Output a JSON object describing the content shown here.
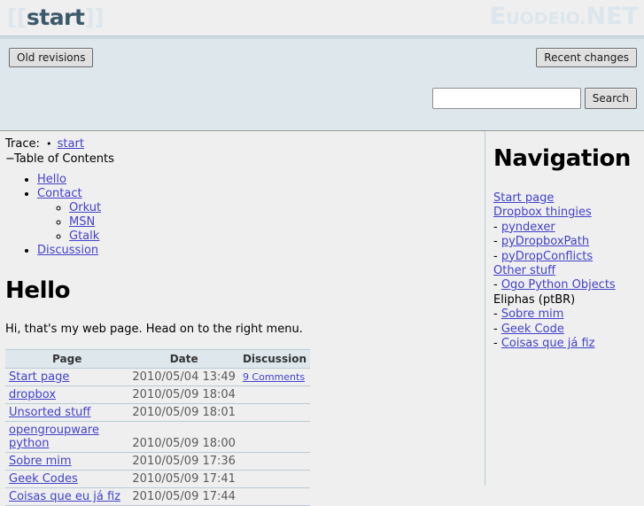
{
  "header": {
    "wiki_title_open": "[[",
    "wiki_title": "start",
    "wiki_title_close": "]]",
    "site_logo_parts": [
      "E",
      "UODEIO",
      ".",
      "NET"
    ],
    "site_logo_text": "Euodeio.NET"
  },
  "toolbar": {
    "old_revisions_label": "Old revisions",
    "recent_changes_label": "Recent changes",
    "search_label": "Search",
    "search_value": "",
    "search_placeholder": ""
  },
  "trace": {
    "label": "Trace:",
    "bullet": "•",
    "items": [
      {
        "label": "start"
      }
    ]
  },
  "toc": {
    "minus": "−",
    "title": "Table of Contents",
    "items": [
      {
        "label": "Hello",
        "level": 1
      },
      {
        "label": "Contact",
        "level": 1
      },
      {
        "label": "Orkut",
        "level": 2
      },
      {
        "label": "MSN",
        "level": 2
      },
      {
        "label": "Gtalk",
        "level": 2
      },
      {
        "label": "Discussion",
        "level": 1
      }
    ]
  },
  "main": {
    "heading": "Hello",
    "intro": "Hi, that's my web page. Head on to the right menu.",
    "table": {
      "columns": [
        "Page",
        "Date",
        "Discussion"
      ],
      "rows": [
        {
          "page": "Start page",
          "date": "2010/05/04 13:49",
          "discussion": "9 Comments"
        },
        {
          "page": "dropbox",
          "date": "2010/05/09 18:04",
          "discussion": ""
        },
        {
          "page": "Unsorted stuff",
          "date": "2010/05/09 18:01",
          "discussion": ""
        },
        {
          "page": "opengroupware python",
          "date": "2010/05/09 18:00",
          "discussion": ""
        },
        {
          "page": "Sobre mim",
          "date": "2010/05/09 17:36",
          "discussion": ""
        },
        {
          "page": "Geek Codes",
          "date": "2010/05/09 17:41",
          "discussion": ""
        },
        {
          "page": "Coisas que eu já fiz",
          "date": "2010/05/09 17:44",
          "discussion": ""
        }
      ]
    }
  },
  "nav": {
    "heading": "Navigation",
    "items": [
      {
        "label": "Start page",
        "link": true,
        "dash": false
      },
      {
        "label": "Dropbox thingies",
        "link": true,
        "dash": false
      },
      {
        "label": "pyndexer",
        "link": true,
        "dash": true
      },
      {
        "label": "pyDropboxPath",
        "link": true,
        "dash": true
      },
      {
        "label": "pyDropConflicts",
        "link": true,
        "dash": true
      },
      {
        "label": "Other stuff",
        "link": true,
        "dash": false
      },
      {
        "label": "Ogo Python Objects",
        "link": true,
        "dash": true
      },
      {
        "label": "Eliphas (ptBR)",
        "link": false,
        "dash": false
      },
      {
        "label": "Sobre mim",
        "link": true,
        "dash": true
      },
      {
        "label": "Geek Code",
        "link": true,
        "dash": true
      },
      {
        "label": "Coisas que já fiz",
        "link": true,
        "dash": true
      }
    ]
  },
  "colors": {
    "page_background": "#efefef",
    "toolbar_background": "#dee7ec",
    "logo_accent": "#dce6ec",
    "title_accent": "#3b5a6b",
    "link": "#4242cc",
    "rule": "#b9cbd5"
  }
}
